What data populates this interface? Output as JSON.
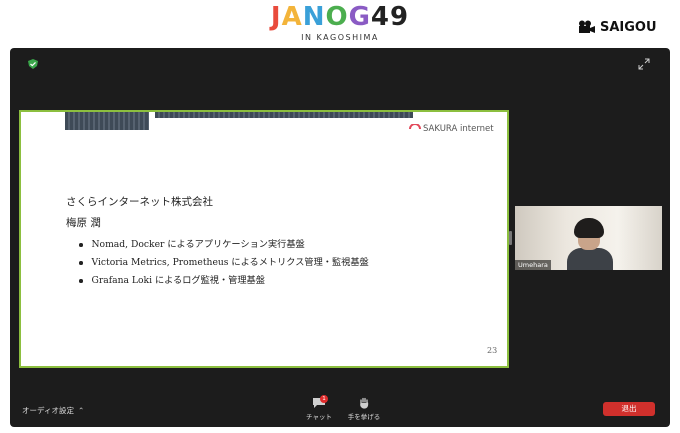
{
  "banner": {
    "logo_text": "JANOG49",
    "logo_subtitle": "IN KAGOSHIMA",
    "brand": "SAIGOU"
  },
  "slide": {
    "logo_text": "SAKURA internet",
    "company": "さくらインターネット株式会社",
    "presenter": "梅原 潤",
    "bullets": [
      "Nomad, Docker によるアプリケーション実行基盤",
      "Victoria Metrics, Prometheus によるメトリクス管理・監視基盤",
      "Grafana Loki によるログ監視・管理基盤"
    ],
    "page_number": "23"
  },
  "webcam": {
    "participant_name": "Umehara"
  },
  "toolbar": {
    "audio_settings": "オーディオ設定",
    "chat_label": "チャット",
    "chat_badge": "1",
    "raise_hand_label": "手を挙げる",
    "leave_label": "退出"
  },
  "colors": {
    "accent_green": "#8cbf3f",
    "leave_red": "#d0302c",
    "window_bg": "#1c1c1c"
  },
  "icons": [
    "video-camera-icon",
    "shield-icon",
    "expand-icon",
    "sakura-logo-icon",
    "chevron-up-icon",
    "chat-icon",
    "raise-hand-icon"
  ]
}
